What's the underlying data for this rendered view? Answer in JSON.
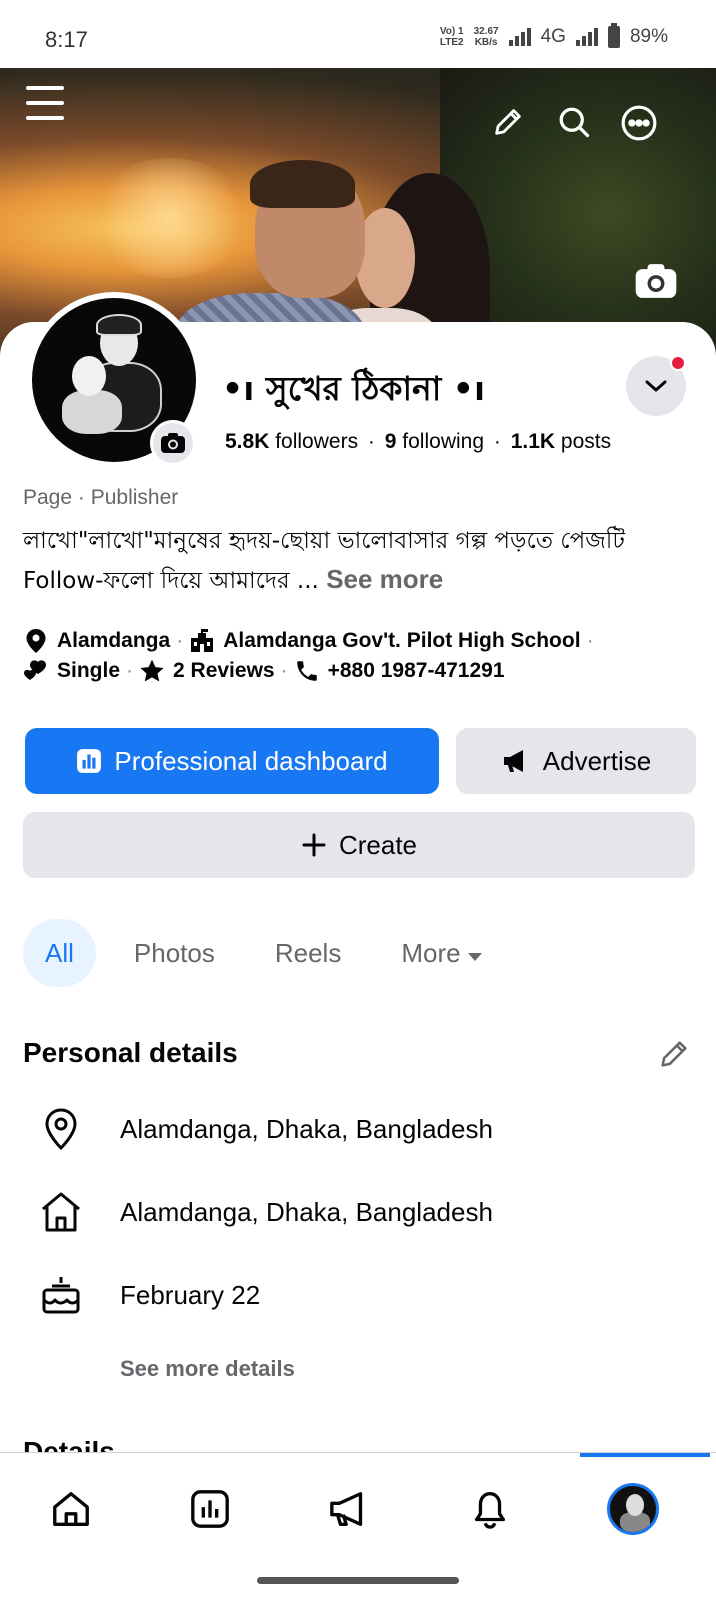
{
  "status_bar": {
    "time": "8:17",
    "volte_top": "Vo) 1",
    "volte_bottom": "LTE2",
    "speed_value": "32.67",
    "speed_unit": "KB/s",
    "network": "4G",
    "battery": "89%"
  },
  "page": {
    "title": "•ו সুখের ঠিকানা •ו",
    "followers_count": "5.8K",
    "followers_label": "followers",
    "following_count": "9",
    "following_label": "following",
    "posts_count": "1.1K",
    "posts_label": "posts",
    "category": "Page · Publisher",
    "bio": "লাখো\"লাখো\"মানুষের হৃদয়-ছোয়া ভালোবাসার গল্প পড়তে পেজটি Follow-ফলো দিয়ে আমাদের ...",
    "see_more": "See more"
  },
  "intro": {
    "location": "Alamdanga",
    "school": "Alamdanga Gov't. Pilot High  School",
    "relationship": "Single",
    "reviews": "2 Reviews",
    "phone": "+880 1987-471291"
  },
  "actions": {
    "dashboard_label": "Professional dashboard",
    "advertise_label": "Advertise",
    "create_label": "Create"
  },
  "tabs": [
    {
      "label": "All",
      "active": true
    },
    {
      "label": "Photos"
    },
    {
      "label": "Reels"
    },
    {
      "label": "More"
    }
  ],
  "personal_details": {
    "title": "Personal details",
    "current_city": "Alamdanga, Dhaka, Bangladesh",
    "hometown": "Alamdanga, Dhaka, Bangladesh",
    "birthday": "February 22",
    "see_more_details": "See more details"
  },
  "details_section": {
    "title": "Details"
  },
  "icons": {
    "menu": "menu-icon",
    "edit": "pencil-icon",
    "search": "search-icon",
    "more": "more-dots-icon",
    "camera": "camera-icon",
    "dropdown": "chevron-down-icon"
  },
  "colors": {
    "accent": "#1877f2",
    "secondary_bg": "#e4e6eb",
    "notification": "#e41e3f"
  }
}
